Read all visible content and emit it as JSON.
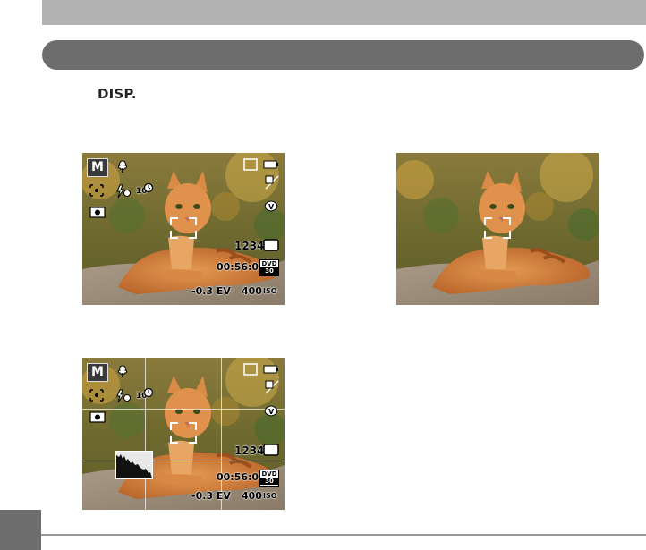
{
  "header": {
    "disp_label": "DISP."
  },
  "screens": {
    "full": {
      "mode": "M",
      "shot_count": "1234",
      "rec_time": "00:56:00",
      "exposure": "-0.3 EV",
      "iso_value": "400",
      "iso_unit": "ISO",
      "timer": "10",
      "video_badge_top": "DVD",
      "video_badge_bottom": "30"
    },
    "grid": {
      "mode": "M",
      "shot_count": "1234",
      "rec_time": "00:56:00",
      "exposure": "-0.3 EV",
      "iso_value": "400",
      "iso_unit": "ISO",
      "timer": "10",
      "video_badge_top": "DVD",
      "video_badge_bottom": "30"
    }
  },
  "colors": {
    "topbar": "#b3b3b3",
    "pill": "#6d6d6d",
    "tab": "#6d6d6d"
  }
}
